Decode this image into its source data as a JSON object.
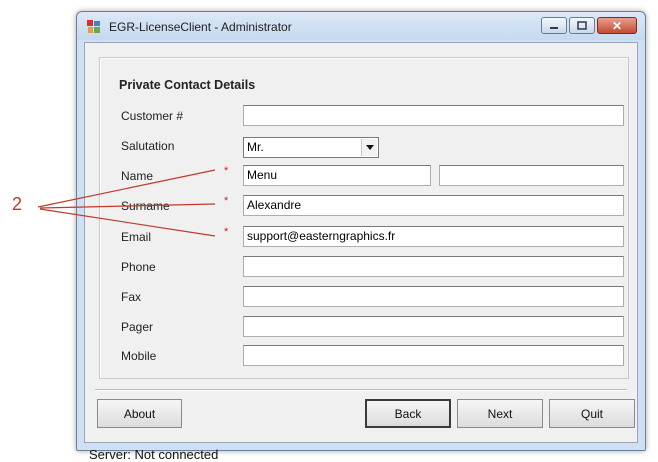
{
  "window": {
    "title": "EGR-LicenseClient - Administrator",
    "icon": "app-icon",
    "controls": {
      "minimize": "minimize-icon",
      "maximize": "maximize-icon",
      "close": "close-icon"
    }
  },
  "section": {
    "title": "Private Contact Details"
  },
  "fields": {
    "customer": {
      "label": "Customer #",
      "value": ""
    },
    "salutation": {
      "label": "Salutation",
      "value": "Mr."
    },
    "name": {
      "label": "Name",
      "first": "Menu",
      "second": ""
    },
    "surname": {
      "label": "Surname",
      "value": "Alexandre"
    },
    "email": {
      "label": "Email",
      "value": "support@easterngraphics.fr"
    },
    "phone": {
      "label": "Phone",
      "value": ""
    },
    "fax": {
      "label": "Fax",
      "value": ""
    },
    "pager": {
      "label": "Pager",
      "value": ""
    },
    "mobile": {
      "label": "Mobile",
      "value": ""
    }
  },
  "required_marker": "*",
  "buttons": {
    "about": "About",
    "back": "Back",
    "next": "Next",
    "quit": "Quit"
  },
  "status": {
    "server": "Server:  Not connected"
  },
  "annotation": {
    "number": "2",
    "color": "#c0392b"
  },
  "colors": {
    "close_button": "#c24a31",
    "title_bar": "#c5d9ef"
  }
}
